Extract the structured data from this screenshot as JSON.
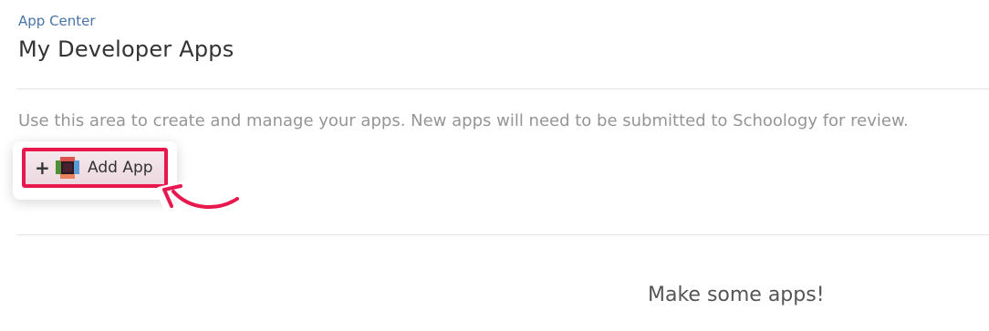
{
  "breadcrumb": "App Center",
  "page_title": "My Developer Apps",
  "description": "Use this area to create and manage your apps. New apps will need to be submitted to Schoology for review.",
  "add_button": {
    "plus": "+",
    "icon": "app-blocks-icon",
    "label": "Add App"
  },
  "empty_state": "Make some apps!",
  "colors": {
    "link": "#4a74a8",
    "highlight": "#e8184f"
  }
}
